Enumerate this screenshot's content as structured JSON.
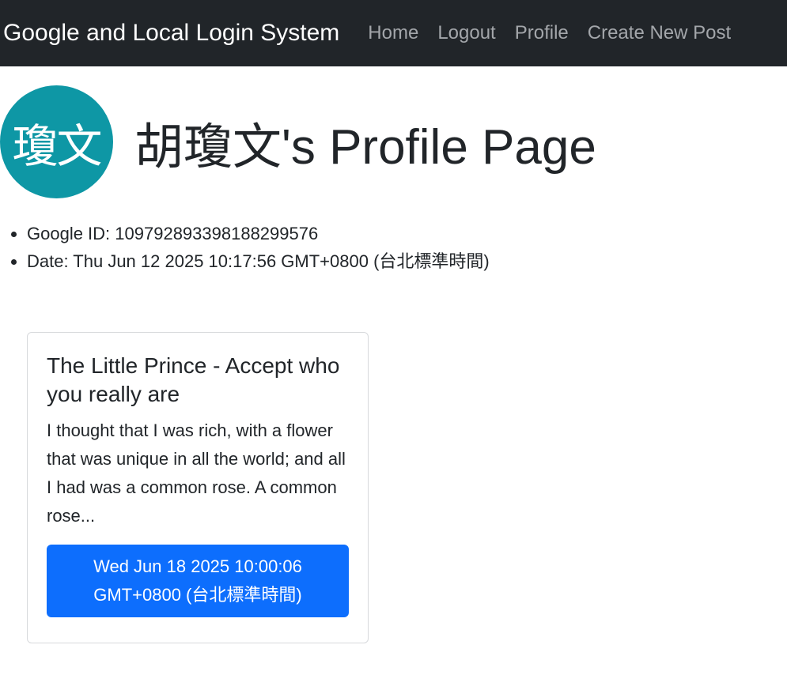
{
  "navbar": {
    "brand": "Google and Local Login System",
    "links": [
      "Home",
      "Logout",
      "Profile",
      "Create New Post"
    ]
  },
  "profile": {
    "avatar_text": "瓊文",
    "avatar_color": "#0e97a5",
    "title": "胡瓊文's Profile Page",
    "info": [
      "Google ID: 109792893398188299576",
      "Date: Thu Jun 12 2025 10:17:56 GMT+0800 (台北標準時間)"
    ]
  },
  "post": {
    "title": "The Little Prince - Accept who you really are",
    "excerpt": "I thought that I was rich, with a flower that was unique in all the world; and all I had was a common rose. A common rose...",
    "date_button": "Wed Jun 18 2025 10:00:06 GMT+0800 (台北標準時間)",
    "button_color": "#0d6efd"
  },
  "colors": {
    "navbar_bg": "#212529",
    "nav_link": "#a3a6aa"
  }
}
